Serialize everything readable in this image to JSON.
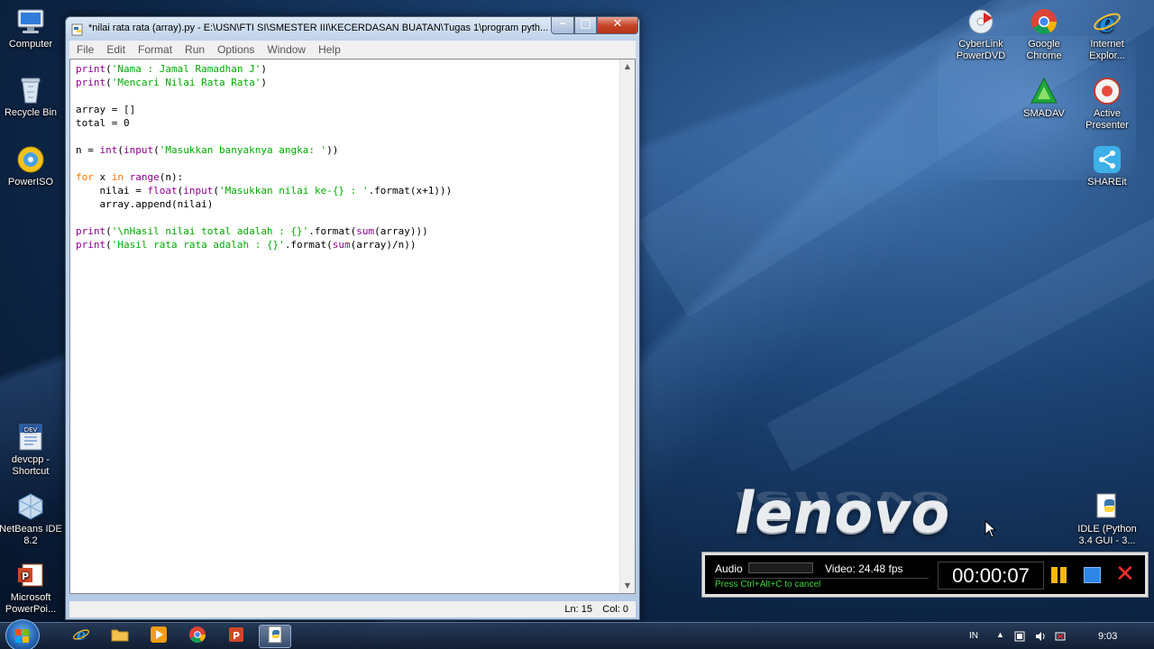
{
  "desktop": {
    "brand": "lenovo",
    "icons_left": [
      {
        "label": "Computer"
      },
      {
        "label": "Recycle Bin"
      },
      {
        "label": "PowerISO"
      },
      {
        "label": "devcpp - Shortcut"
      },
      {
        "label": "NetBeans IDE 8.2"
      },
      {
        "label": "Microsoft PowerPoi..."
      }
    ],
    "icons_right": [
      {
        "label": "CyberLink PowerDVD"
      },
      {
        "label": "Google Chrome"
      },
      {
        "label": "Internet Explor..."
      },
      {
        "label": "SMADAV"
      },
      {
        "label": "Active Presenter"
      },
      {
        "label": "SHAREit"
      },
      {
        "label": "IDLE (Python 3.4 GUI - 3..."
      }
    ]
  },
  "window": {
    "title": "*nilai rata rata (array).py - E:\\USN\\FTI  SI\\SMESTER III\\KECERDASAN BUATAN\\Tugas 1\\program pyth...",
    "minimize_label": "–",
    "maximize_label": "□",
    "close_label": "✕",
    "menu": [
      "File",
      "Edit",
      "Format",
      "Run",
      "Options",
      "Window",
      "Help"
    ],
    "status": {
      "line": "Ln: 15",
      "col": "Col: 0"
    }
  },
  "code_lines": [
    [
      [
        "bi",
        "print"
      ],
      [
        "n",
        "("
      ],
      [
        "st",
        "'Nama : Jamal Ramadhan J'"
      ],
      [
        "n",
        ")"
      ]
    ],
    [
      [
        "bi",
        "print"
      ],
      [
        "n",
        "("
      ],
      [
        "st",
        "'Mencari Nilai Rata Rata'"
      ],
      [
        "n",
        ")"
      ]
    ],
    [],
    [
      [
        "n",
        "array = []"
      ]
    ],
    [
      [
        "n",
        "total = 0"
      ]
    ],
    [],
    [
      [
        "n",
        "n = "
      ],
      [
        "bi",
        "int"
      ],
      [
        "n",
        "("
      ],
      [
        "bi",
        "input"
      ],
      [
        "n",
        "("
      ],
      [
        "st",
        "'Masukkan banyaknya angka: '"
      ],
      [
        "n",
        "))"
      ]
    ],
    [],
    [
      [
        "kw",
        "for"
      ],
      [
        "n",
        " x "
      ],
      [
        "kw",
        "in"
      ],
      [
        "n",
        " "
      ],
      [
        "bi",
        "range"
      ],
      [
        "n",
        "(n):"
      ]
    ],
    [
      [
        "n",
        "    nilai = "
      ],
      [
        "bi",
        "float"
      ],
      [
        "n",
        "("
      ],
      [
        "bi",
        "input"
      ],
      [
        "n",
        "("
      ],
      [
        "st",
        "'Masukkan nilai ke-{} : '"
      ],
      [
        "n",
        ".format(x+1)))"
      ]
    ],
    [
      [
        "n",
        "    array.append(nilai)"
      ]
    ],
    [],
    [
      [
        "bi",
        "print"
      ],
      [
        "n",
        "("
      ],
      [
        "st",
        "'\\nHasil nilai total adalah : {}'"
      ],
      [
        "n",
        ".format("
      ],
      [
        "bi",
        "sum"
      ],
      [
        "n",
        "(array)))"
      ]
    ],
    [
      [
        "bi",
        "print"
      ],
      [
        "n",
        "("
      ],
      [
        "st",
        "'Hasil rata rata adalah : {}'"
      ],
      [
        "n",
        ".format("
      ],
      [
        "bi",
        "sum"
      ],
      [
        "n",
        "(array)/n))"
      ]
    ]
  ],
  "recorder": {
    "audio_label": "Audio",
    "video_label": "Video: 24.48 fps",
    "hint": "Press Ctrl+Alt+C to cancel",
    "timer": "00:00:07"
  },
  "taskbar": {
    "language": "IN",
    "clock": "9:03"
  }
}
